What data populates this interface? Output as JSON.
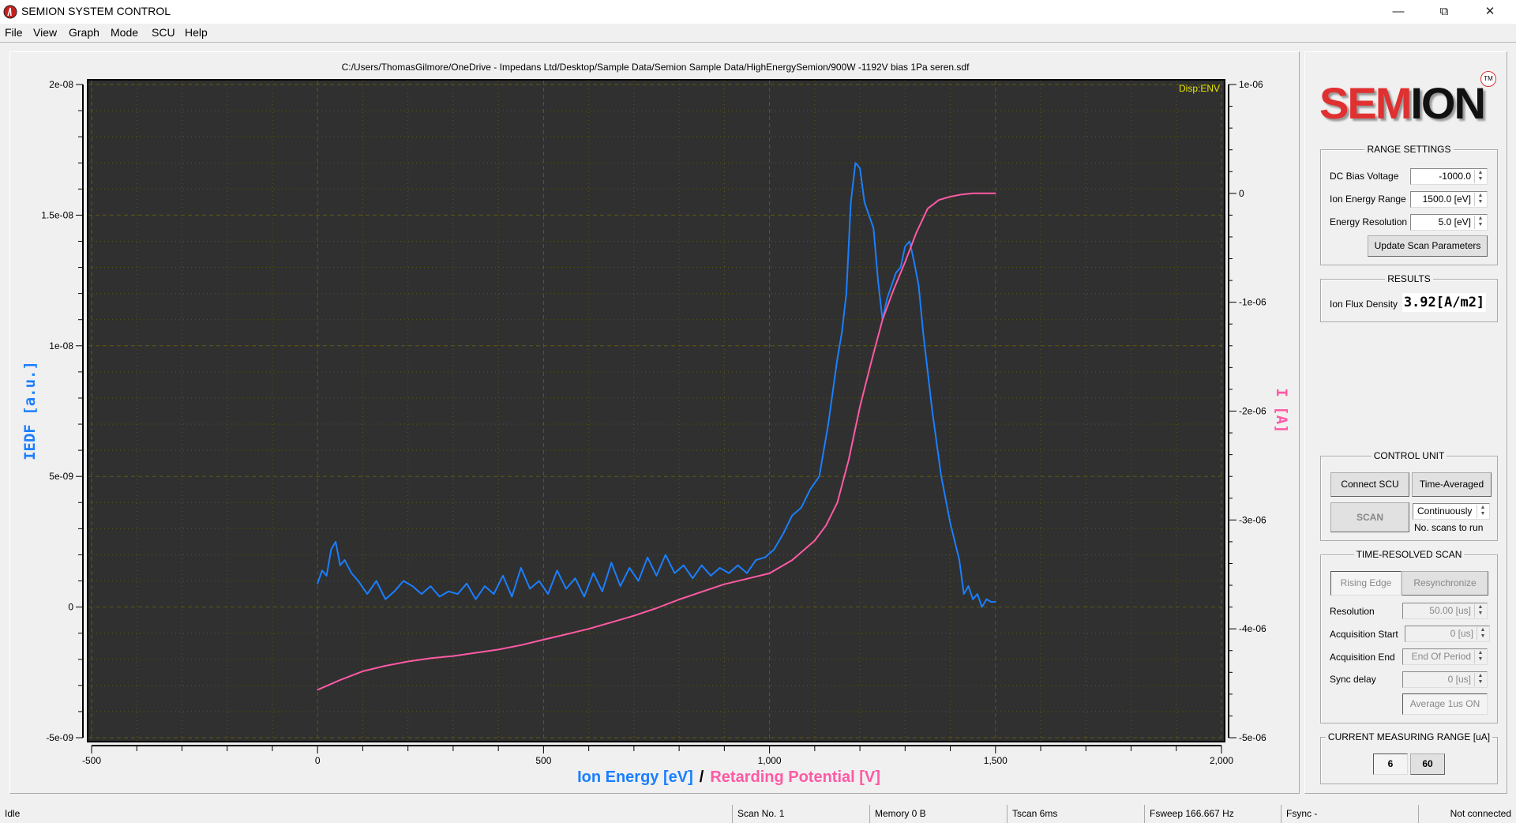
{
  "window": {
    "title": "SEMION SYSTEM CONTROL"
  },
  "menu": [
    "File",
    "View",
    "Graph",
    "Mode",
    "SCU",
    "Help"
  ],
  "graph": {
    "file_path": "C:/Users/ThomasGilmore/OneDrive - Impedans Ltd/Desktop/Sample Data/Semion Sample Data/HighEnergySemion/900W -1192V bias 1Pa seren.sdf",
    "display_mode": "Disp:ENV",
    "xlabel_part1": "Ion Energy [eV]",
    "xlabel_sep": "/",
    "xlabel_part2": "Retarding Potential [V]",
    "ylabel_left": "IEDF [a.u.]",
    "ylabel_right": "I [A]"
  },
  "chart_data": {
    "type": "line",
    "xlim": [
      -500,
      2000
    ],
    "x_ticks": [
      "-500",
      "0",
      "500",
      "1,000",
      "1,500",
      "2,000"
    ],
    "x_tick_values": [
      -500,
      0,
      500,
      1000,
      1500,
      2000
    ],
    "ylim_left": [
      -5e-09,
      2e-08
    ],
    "y_left_ticks": [
      "2e-08",
      "1.5e-08",
      "1e-08",
      "5e-09",
      "0",
      "-5e-09"
    ],
    "y_left_tick_values": [
      2e-08,
      1.5e-08,
      1e-08,
      5e-09,
      0,
      -5e-09
    ],
    "ylim_right": [
      -5e-06,
      1e-06
    ],
    "y_right_ticks": [
      "1e-06",
      "0",
      "-1e-06",
      "-2e-06",
      "-3e-06",
      "-4e-06",
      "-5e-06"
    ],
    "y_right_tick_values": [
      1e-06,
      0,
      -1e-06,
      -2e-06,
      -3e-06,
      -4e-06,
      -5e-06
    ],
    "grid": true,
    "colors": {
      "iedf": "#1a7fff",
      "current": "#ff5aa5",
      "grid": "#5c5a10",
      "plot_bg": "#303030"
    },
    "series": [
      {
        "name": "IEDF",
        "axis": "left",
        "x": [
          0,
          10,
          20,
          30,
          40,
          50,
          60,
          75,
          90,
          110,
          130,
          150,
          170,
          190,
          210,
          230,
          250,
          270,
          290,
          310,
          330,
          350,
          370,
          390,
          410,
          430,
          450,
          470,
          490,
          510,
          530,
          550,
          570,
          590,
          610,
          630,
          650,
          670,
          690,
          710,
          730,
          750,
          770,
          790,
          810,
          830,
          850,
          870,
          890,
          910,
          930,
          950,
          970,
          990,
          1010,
          1030,
          1050,
          1070,
          1090,
          1110,
          1130,
          1150,
          1160,
          1170,
          1180,
          1190,
          1200,
          1210,
          1220,
          1230,
          1240,
          1250,
          1260,
          1270,
          1280,
          1290,
          1300,
          1310,
          1320,
          1330,
          1340,
          1360,
          1380,
          1400,
          1420,
          1430,
          1440,
          1450,
          1460,
          1470,
          1480,
          1490,
          1500
        ],
        "y": [
          9e-10,
          1.4e-09,
          1.2e-09,
          2.2e-09,
          2.5e-09,
          1.6e-09,
          1.8e-09,
          1.3e-09,
          1e-09,
          5e-10,
          1e-09,
          3e-10,
          6e-10,
          1e-09,
          8e-10,
          5e-10,
          8e-10,
          4e-10,
          6e-10,
          5e-10,
          9e-10,
          3e-10,
          8e-10,
          5e-10,
          1.2e-09,
          4e-10,
          1.5e-09,
          7e-10,
          1e-09,
          5e-10,
          1.4e-09,
          7e-10,
          1.1e-09,
          4e-10,
          1.3e-09,
          6e-10,
          1.7e-09,
          8e-10,
          1.5e-09,
          1e-09,
          1.9e-09,
          1.2e-09,
          2e-09,
          1.3e-09,
          1.6e-09,
          1.1e-09,
          1.6e-09,
          1.2e-09,
          1.5e-09,
          1.3e-09,
          1.6e-09,
          1.3e-09,
          1.8e-09,
          1.9e-09,
          2.2e-09,
          2.8e-09,
          3.5e-09,
          3.8e-09,
          4.5e-09,
          5e-09,
          7e-09,
          9.5e-09,
          1.05e-08,
          1.2e-08,
          1.55e-08,
          1.7e-08,
          1.68e-08,
          1.55e-08,
          1.5e-08,
          1.45e-08,
          1.25e-08,
          1.1e-08,
          1.18e-08,
          1.23e-08,
          1.28e-08,
          1.3e-08,
          1.38e-08,
          1.4e-08,
          1.32e-08,
          1.23e-08,
          1.05e-08,
          7.5e-09,
          5e-09,
          3.2e-09,
          1.8e-09,
          5e-10,
          8e-10,
          3e-10,
          5e-10,
          0.0,
          3e-10,
          2e-10,
          2e-10
        ]
      },
      {
        "name": "Current",
        "axis": "right",
        "x": [
          0,
          50,
          100,
          150,
          200,
          250,
          300,
          350,
          400,
          450,
          500,
          550,
          600,
          650,
          700,
          750,
          800,
          850,
          900,
          950,
          1000,
          1050,
          1100,
          1125,
          1150,
          1175,
          1200,
          1225,
          1250,
          1275,
          1300,
          1325,
          1350,
          1375,
          1400,
          1425,
          1450,
          1475,
          1500
        ],
        "y": [
          -4.56e-06,
          -4.47e-06,
          -4.39e-06,
          -4.34e-06,
          -4.3e-06,
          -4.27e-06,
          -4.25e-06,
          -4.22e-06,
          -4.19e-06,
          -4.15e-06,
          -4.1e-06,
          -4.05e-06,
          -4e-06,
          -3.94e-06,
          -3.88e-06,
          -3.81e-06,
          -3.73e-06,
          -3.66e-06,
          -3.59e-06,
          -3.54e-06,
          -3.49e-06,
          -3.37e-06,
          -3.19e-06,
          -3.05e-06,
          -2.84e-06,
          -2.45e-06,
          -1.96e-06,
          -1.55e-06,
          -1.16e-06,
          -8.8e-07,
          -6.3e-07,
          -3.6e-07,
          -1.4e-07,
          -6e-08,
          -3e-08,
          -1e-08,
          0.0,
          0.0,
          0.0
        ]
      }
    ]
  },
  "right_panel": {
    "logo": {
      "red": "SEM",
      "black": "ION",
      "tm": "TM"
    },
    "range_settings": {
      "title": "RANGE SETTINGS",
      "dc_bias_label": "DC Bias Voltage",
      "dc_bias_value": "-1000.0",
      "ion_energy_range_label": "Ion Energy Range",
      "ion_energy_range_value": "1500.0 [eV]",
      "energy_resolution_label": "Energy Resolution",
      "energy_resolution_value": "5.0 [eV]",
      "update_button": "Update Scan Parameters"
    },
    "results": {
      "title": "RESULTS",
      "ion_flux_label": "Ion Flux Density",
      "ion_flux_value": "3.92[A/m2]"
    },
    "control_unit": {
      "title": "CONTROL UNIT",
      "connect_button": "Connect SCU",
      "mode_button": "Time-Averaged",
      "scan_button": "SCAN",
      "scans_value": "Continuously",
      "scans_label": "No. scans to run"
    },
    "time_resolved": {
      "title": "TIME-RESOLVED SCAN",
      "rising_edge": "Rising Edge",
      "resync": "Resynchronize",
      "resolution_label": "Resolution",
      "resolution_value": "50.00 [us]",
      "acq_start_label": "Acquisition Start",
      "acq_start_value": "0 [us]",
      "acq_end_label": "Acquisition End",
      "acq_end_value": "End Of Period",
      "sync_delay_label": "Sync delay",
      "sync_delay_value": "0 [us]",
      "average_button": "Average 1us  ON"
    },
    "current_range": {
      "title": "CURRENT MEASURING RANGE [uA]",
      "opt1": "6",
      "opt2": "60"
    }
  },
  "status": {
    "state": "Idle",
    "scan_no": "Scan No. 1",
    "memory": "Memory 0  B",
    "tscan": "Tscan 6ms",
    "fsweep": "Fsweep 166.667  Hz",
    "fsync": "Fsync    -",
    "connection": "Not connected"
  }
}
